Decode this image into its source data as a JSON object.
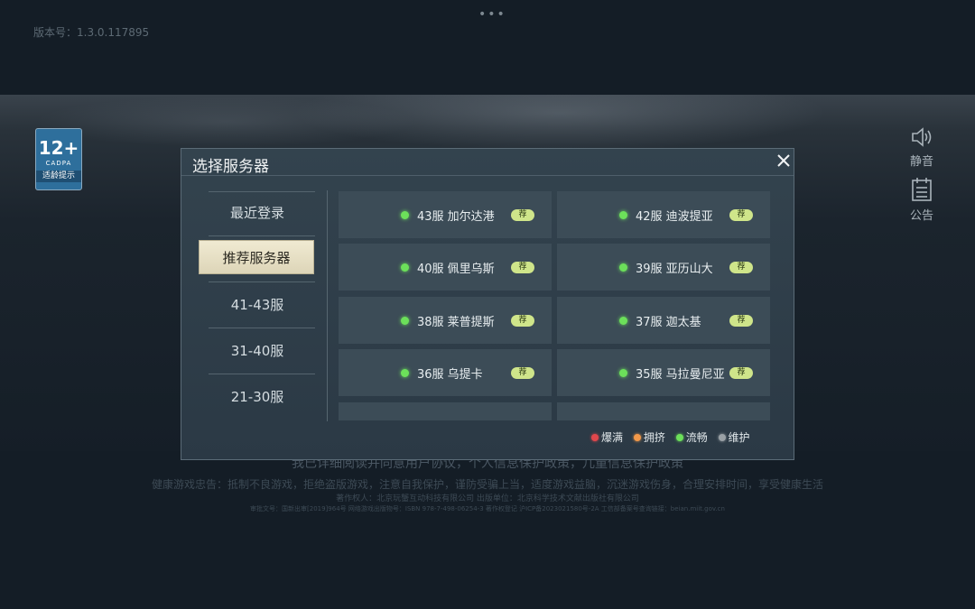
{
  "top": {
    "dots": "•••",
    "version": "版本号：1.3.0.117895"
  },
  "age_badge": {
    "age": "12+",
    "org": "CADPA",
    "tip": "适龄提示"
  },
  "side_buttons": {
    "mute": {
      "label": "静音",
      "icon": "speaker-icon"
    },
    "notice": {
      "label": "公告",
      "icon": "notice-board-icon"
    }
  },
  "footer": {
    "agree": "我已详细阅读并同意用户协议，个人信息保护政策，儿童信息保护政策",
    "health": "健康游戏忠告：抵制不良游戏，拒绝盗版游戏，注意自我保护，谨防受骗上当，适度游戏益脑，沉迷游戏伤身，合理安排时间，享受健康生活",
    "copyright": "著作权人：北京玩蟹互动科技有限公司  出版单位：北京科学技术文献出版社有限公司",
    "approval": "审批文号：国新出审[2019]964号 网络游戏出版物号：ISBN 978-7-498-06254-3 著作权登记 沪ICP备2023021580号-2A 工信部备案号查询链接：beian.miit.gov.cn"
  },
  "dialog": {
    "title": "选择服务器",
    "close_icon": "close-icon",
    "tabs": [
      {
        "label": "最近登录",
        "selected": false
      },
      {
        "label": "推荐服务器",
        "selected": true
      },
      {
        "label": "41-43服",
        "selected": false
      },
      {
        "label": "31-40服",
        "selected": false
      },
      {
        "label": "21-30服",
        "selected": false
      }
    ],
    "servers": [
      {
        "name": "43服 加尔达港",
        "tag": "荐",
        "status": "流畅"
      },
      {
        "name": "42服 迪波提亚",
        "tag": "荐",
        "status": "流畅"
      },
      {
        "name": "40服 佩里乌斯",
        "tag": "荐",
        "status": "流畅"
      },
      {
        "name": "39服 亚历山大",
        "tag": "荐",
        "status": "流畅"
      },
      {
        "name": "38服 莱普提斯",
        "tag": "荐",
        "status": "流畅"
      },
      {
        "name": "37服 迦太基",
        "tag": "荐",
        "status": "流畅"
      },
      {
        "name": "36服 乌提卡",
        "tag": "荐",
        "status": "流畅"
      },
      {
        "name": "35服 马拉曼尼亚",
        "tag": "荐",
        "status": "流畅"
      }
    ],
    "legend": [
      {
        "label": "爆满",
        "color": "#e0474c"
      },
      {
        "label": "拥挤",
        "color": "#f2994a"
      },
      {
        "label": "流畅",
        "color": "#6ce05a"
      },
      {
        "label": "维护",
        "color": "#9aa1a6"
      }
    ]
  }
}
